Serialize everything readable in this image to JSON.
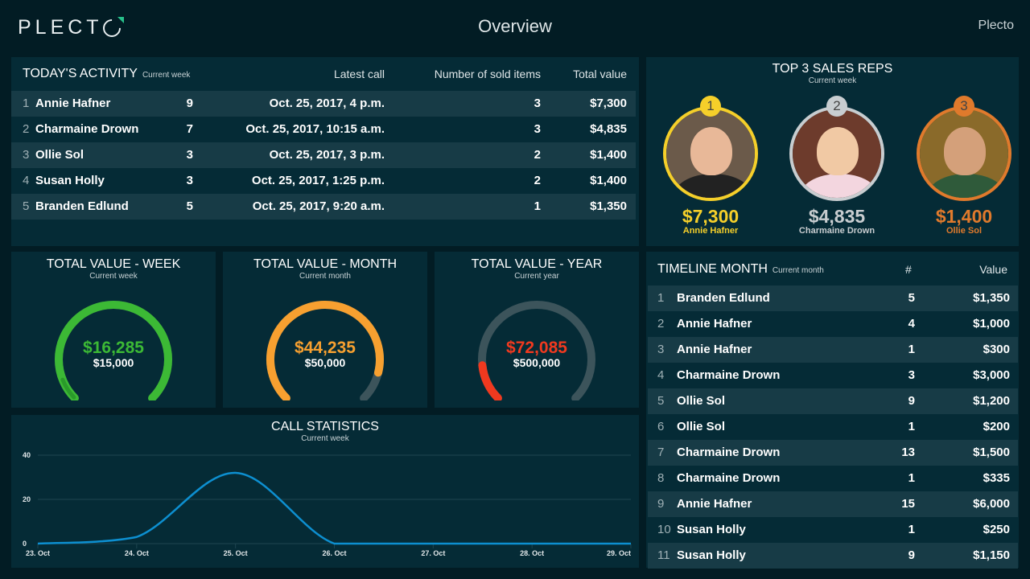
{
  "header": {
    "logo_text": "PLECT",
    "title": "Overview",
    "account": "Plecto",
    "logo_accent": "#27c08a"
  },
  "activity": {
    "title": "TODAY'S ACTIVITY",
    "subtitle": "Current week",
    "columns": [
      "Latest call",
      "Number of sold items",
      "Total value"
    ],
    "rows": [
      {
        "rank": "1",
        "name": "Annie Hafner",
        "calls": "9",
        "latest": "Oct. 25, 2017, 4 p.m.",
        "items": "3",
        "value": "$7,300"
      },
      {
        "rank": "2",
        "name": "Charmaine Drown",
        "calls": "7",
        "latest": "Oct. 25, 2017, 10:15 a.m.",
        "items": "3",
        "value": "$4,835"
      },
      {
        "rank": "3",
        "name": "Ollie Sol",
        "calls": "3",
        "latest": "Oct. 25, 2017, 3 p.m.",
        "items": "2",
        "value": "$1,400"
      },
      {
        "rank": "4",
        "name": "Susan Holly",
        "calls": "3",
        "latest": "Oct. 25, 2017, 1:25 p.m.",
        "items": "2",
        "value": "$1,400"
      },
      {
        "rank": "5",
        "name": "Branden Edlund",
        "calls": "5",
        "latest": "Oct. 25, 2017, 9:20 a.m.",
        "items": "1",
        "value": "$1,350"
      }
    ]
  },
  "top3": {
    "title": "TOP 3 SALES REPS",
    "subtitle": "Current week",
    "reps": [
      {
        "rank": "1",
        "amount": "$7,300",
        "name": "Annie Hafner",
        "color": "#f5cf2a"
      },
      {
        "rank": "2",
        "amount": "$4,835",
        "name": "Charmaine Drown",
        "color": "#c8cdd0"
      },
      {
        "rank": "3",
        "amount": "$1,400",
        "name": "Ollie Sol",
        "color": "#e07a2c"
      }
    ]
  },
  "gauges": [
    {
      "title": "TOTAL VALUE - WEEK",
      "subtitle": "Current week",
      "value": "$16,285",
      "target": "$15,000",
      "fraction": 1.0,
      "overflow_fraction": 0.086,
      "color": "#3cb935"
    },
    {
      "title": "TOTAL VALUE - MONTH",
      "subtitle": "Current month",
      "value": "$44,235",
      "target": "$50,000",
      "fraction": 0.885,
      "color": "#f7a030"
    },
    {
      "title": "TOTAL VALUE - YEAR",
      "subtitle": "Current year",
      "value": "$72,085",
      "target": "$500,000",
      "fraction": 0.144,
      "color": "#f0391f"
    }
  ],
  "calls": {
    "title": "CALL STATISTICS",
    "subtitle": "Current week"
  },
  "chart_data": {
    "type": "line",
    "title": "CALL STATISTICS",
    "subtitle": "Current week",
    "x": [
      "23. Oct",
      "24. Oct",
      "25. Oct",
      "26. Oct",
      "27. Oct",
      "28. Oct",
      "29. Oct"
    ],
    "series": [
      {
        "name": "Calls",
        "values": [
          0,
          3,
          32,
          0,
          0,
          0,
          0
        ],
        "color": "#0d8fd0"
      }
    ],
    "yticks": [
      0,
      20,
      40
    ],
    "ylim": [
      0,
      40
    ],
    "xlabel": "",
    "ylabel": "",
    "grid": true
  },
  "timeline": {
    "title": "TIMELINE MONTH",
    "subtitle": "Current month",
    "columns": [
      "#",
      "Value"
    ],
    "rows": [
      {
        "rank": "1",
        "name": "Branden Edlund",
        "count": "5",
        "value": "$1,350"
      },
      {
        "rank": "2",
        "name": "Annie Hafner",
        "count": "4",
        "value": "$1,000"
      },
      {
        "rank": "3",
        "name": "Annie Hafner",
        "count": "1",
        "value": "$300"
      },
      {
        "rank": "4",
        "name": "Charmaine Drown",
        "count": "3",
        "value": "$3,000"
      },
      {
        "rank": "5",
        "name": "Ollie Sol",
        "count": "9",
        "value": "$1,200"
      },
      {
        "rank": "6",
        "name": "Ollie Sol",
        "count": "1",
        "value": "$200"
      },
      {
        "rank": "7",
        "name": "Charmaine Drown",
        "count": "13",
        "value": "$1,500"
      },
      {
        "rank": "8",
        "name": "Charmaine Drown",
        "count": "1",
        "value": "$335"
      },
      {
        "rank": "9",
        "name": "Annie Hafner",
        "count": "15",
        "value": "$6,000"
      },
      {
        "rank": "10",
        "name": "Susan Holly",
        "count": "1",
        "value": "$250"
      },
      {
        "rank": "11",
        "name": "Susan Holly",
        "count": "9",
        "value": "$1,150"
      }
    ]
  }
}
